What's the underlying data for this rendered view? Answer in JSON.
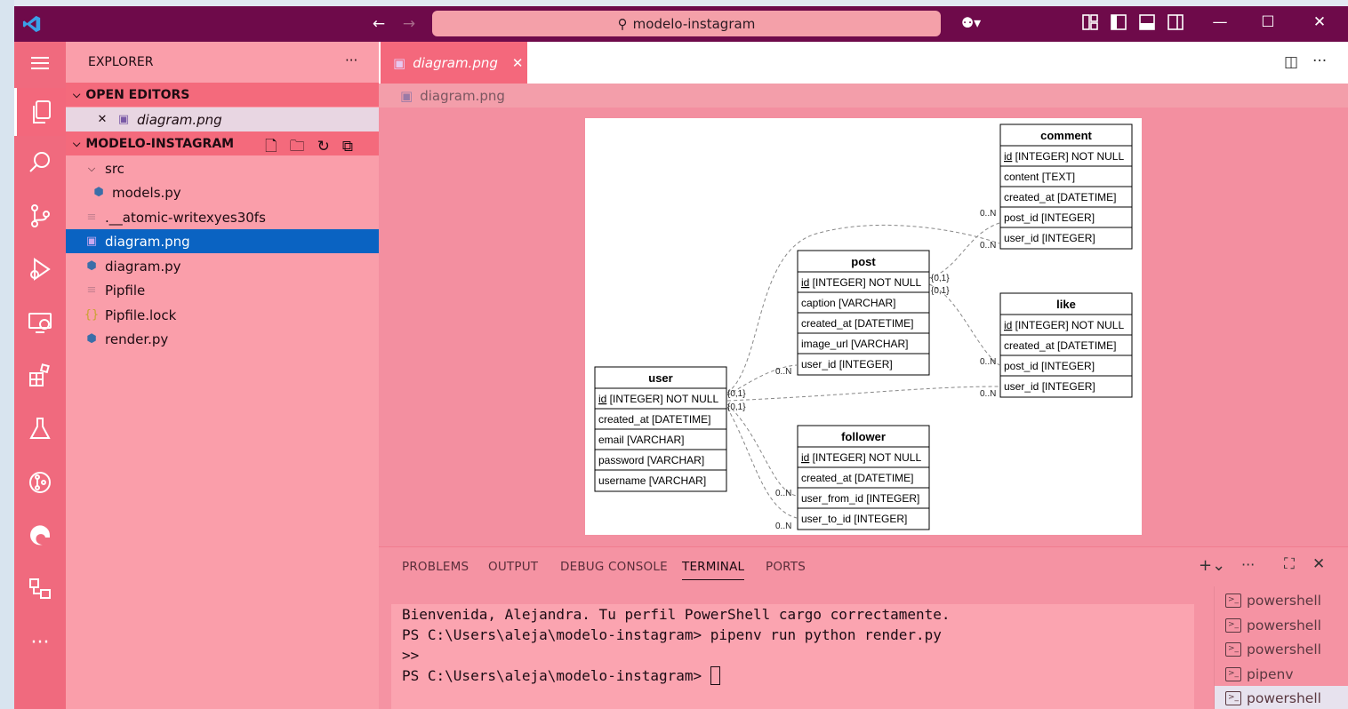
{
  "window": {
    "search_text": "modelo-instagram",
    "accent_color": "#6e0a4a",
    "sidebar_color": "#fa9eaa",
    "activity_color": "#f06a7e"
  },
  "activity_bar": {
    "icons": [
      "menu-icon",
      "explorer-icon",
      "search-icon",
      "source-control-icon",
      "run-debug-icon",
      "remote-explorer-icon",
      "extensions-icon",
      "testing-icon",
      "git-graph-icon",
      "edge-icon",
      "project-manager-icon",
      "more-icon"
    ]
  },
  "explorer": {
    "title": "EXPLORER",
    "more": "···",
    "open_editors": {
      "label": "OPEN EDITORS",
      "items": [
        {
          "name": "diagram.png"
        }
      ]
    },
    "project": {
      "label": "MODELO-INSTAGRAM",
      "items": [
        {
          "name": "src",
          "icon": "chevron-down-icon"
        },
        {
          "name": "models.py",
          "icon": "python-icon"
        },
        {
          "name": ".__atomic-writexyes30fs",
          "icon": "file-icon"
        },
        {
          "name": "diagram.png",
          "icon": "image-icon"
        },
        {
          "name": "diagram.py",
          "icon": "python-icon"
        },
        {
          "name": "Pipfile",
          "icon": "file-icon"
        },
        {
          "name": "Pipfile.lock",
          "icon": "json-icon"
        },
        {
          "name": "render.py",
          "icon": "python-icon"
        }
      ]
    }
  },
  "editor": {
    "tab_label": "diagram.png",
    "breadcrumb": "diagram.png"
  },
  "diagram": {
    "tables": [
      {
        "name": "comment",
        "fields": [
          [
            "id",
            "[INTEGER] NOT NULL"
          ],
          [
            "content",
            "[TEXT]"
          ],
          [
            "created_at",
            "[DATETIME]"
          ],
          [
            "post_id",
            "[INTEGER]"
          ],
          [
            "user_id",
            "[INTEGER]"
          ]
        ]
      },
      {
        "name": "post",
        "fields": [
          [
            "id",
            "[INTEGER] NOT NULL"
          ],
          [
            "caption",
            "[VARCHAR]"
          ],
          [
            "created_at",
            "[DATETIME]"
          ],
          [
            "image_url",
            "[VARCHAR]"
          ],
          [
            "user_id",
            "[INTEGER]"
          ]
        ]
      },
      {
        "name": "like",
        "fields": [
          [
            "id",
            "[INTEGER] NOT NULL"
          ],
          [
            "created_at",
            "[DATETIME]"
          ],
          [
            "post_id",
            "[INTEGER]"
          ],
          [
            "user_id",
            "[INTEGER]"
          ]
        ]
      },
      {
        "name": "user",
        "fields": [
          [
            "id",
            "[INTEGER] NOT NULL"
          ],
          [
            "created_at",
            "[DATETIME]"
          ],
          [
            "email",
            "[VARCHAR]"
          ],
          [
            "password",
            "[VARCHAR]"
          ],
          [
            "username",
            "[VARCHAR]"
          ]
        ]
      },
      {
        "name": "follower",
        "fields": [
          [
            "id",
            "[INTEGER] NOT NULL"
          ],
          [
            "created_at",
            "[DATETIME]"
          ],
          [
            "user_from_id",
            "[INTEGER]"
          ],
          [
            "user_to_id",
            "[INTEGER]"
          ]
        ]
      }
    ],
    "cardinality_many": "0..N",
    "cardinality_one": "{0,1}"
  },
  "panel": {
    "tabs": [
      "PROBLEMS",
      "OUTPUT",
      "DEBUG CONSOLE",
      "TERMINAL",
      "PORTS"
    ],
    "active_tab": "TERMINAL",
    "terminal_lines": [
      "Bienvenida, Alejandra. Tu perfil PowerShell cargo correctamente.",
      "PS C:\\Users\\aleja\\modelo-instagram> pipenv run python render.py",
      ">>",
      "PS C:\\Users\\aleja\\modelo-instagram> "
    ],
    "terminals": [
      "powershell",
      "powershell",
      "powershell",
      "pipenv",
      "powershell"
    ]
  }
}
